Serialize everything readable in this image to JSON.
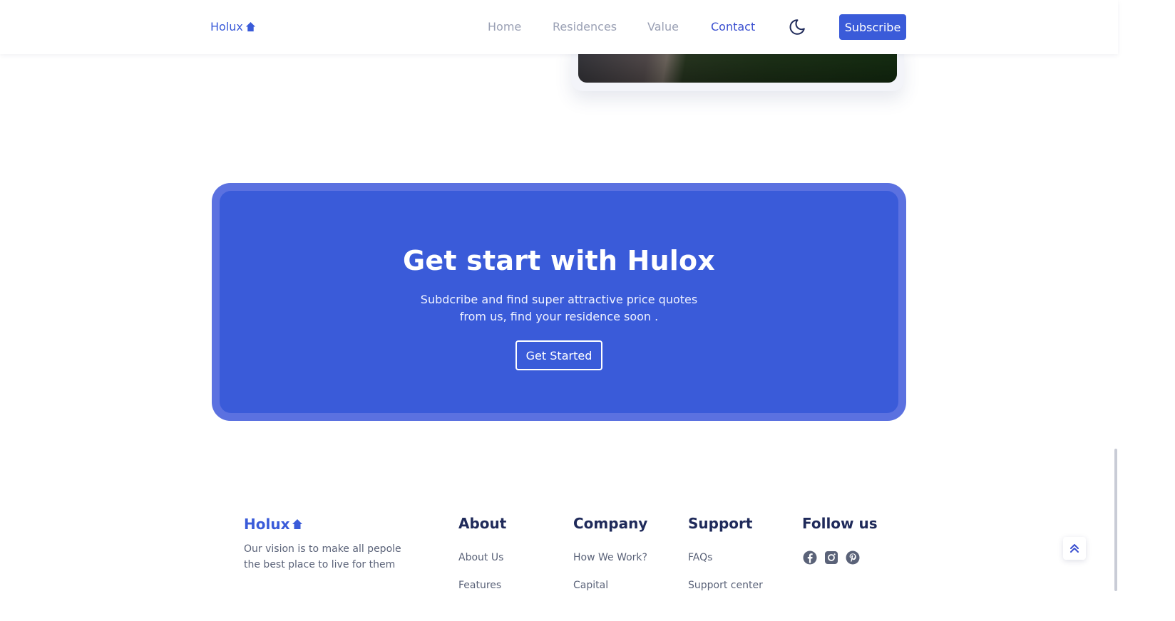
{
  "header": {
    "logo": "Holux",
    "nav": [
      "Home",
      "Residences",
      "Value",
      "Contact"
    ],
    "active_nav": "Contact",
    "subscribe_label": "Subscribe"
  },
  "cta": {
    "title": "Get start with Hulox",
    "text": "Subdcribe and find super attractive price quotes from us, find your residence soon .",
    "button_label": "Get Started"
  },
  "footer": {
    "logo": "Holux",
    "description": "Our vision is to make all pepole the best place to live for them",
    "columns": [
      {
        "title": "About",
        "links": [
          "About Us",
          "Features"
        ]
      },
      {
        "title": "Company",
        "links": [
          "How We Work?",
          "Capital"
        ]
      },
      {
        "title": "Support",
        "links": [
          "FAQs",
          "Support center"
        ]
      }
    ],
    "follow_title": "Follow us",
    "social_icons": [
      "facebook-icon",
      "instagram-icon",
      "pinterest-icon"
    ]
  },
  "colors": {
    "brand": "#3a5bd9",
    "brand_light": "#5b71e0",
    "text_dark": "#1f2a5a",
    "text_muted": "#5a6278"
  }
}
